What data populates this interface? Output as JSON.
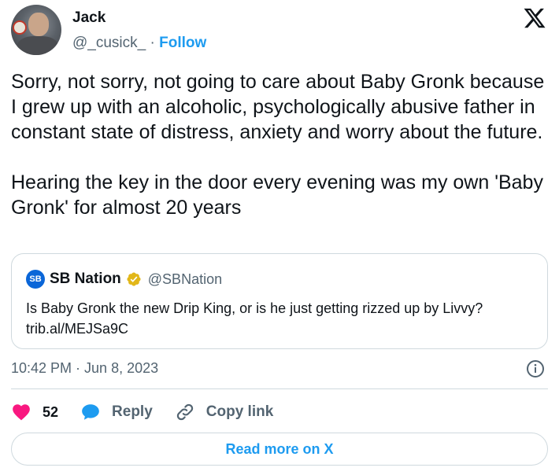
{
  "author": {
    "name": "Jack",
    "handle": "@_cusick_",
    "separator": "·",
    "follow_label": "Follow"
  },
  "tweet": {
    "text": "Sorry, not sorry, not going to care about Baby Gronk because I grew up with an alcoholic, psychologically abusive father in constant state of distress, anxiety and worry about the future.\n\nHearing the key in the door every evening was my own 'Baby Gronk' for almost 20 years"
  },
  "quoted_tweet": {
    "logo_text": "SB",
    "name": "SB Nation",
    "handle": "@SBNation",
    "text": "Is Baby Gronk the new Drip King, or is he just getting rizzed up by Livvy?\ntrib.al/MEJSa9C"
  },
  "meta": {
    "timestamp": "10:42 PM · Jun 8, 2023"
  },
  "actions": {
    "like_count": "52",
    "reply_label": "Reply",
    "copy_link_label": "Copy link"
  },
  "read_more_label": "Read more on X",
  "colors": {
    "accent": "#1d9bf0",
    "like": "#f91880",
    "verified_gold": "#e2b719",
    "text": "#0f1419",
    "secondary": "#536471"
  },
  "icons": {
    "logo": "x-logo-icon",
    "verified": "verified-badge-icon",
    "info": "info-icon",
    "like": "heart-icon",
    "reply": "speech-bubble-icon",
    "copy_link": "link-icon"
  }
}
